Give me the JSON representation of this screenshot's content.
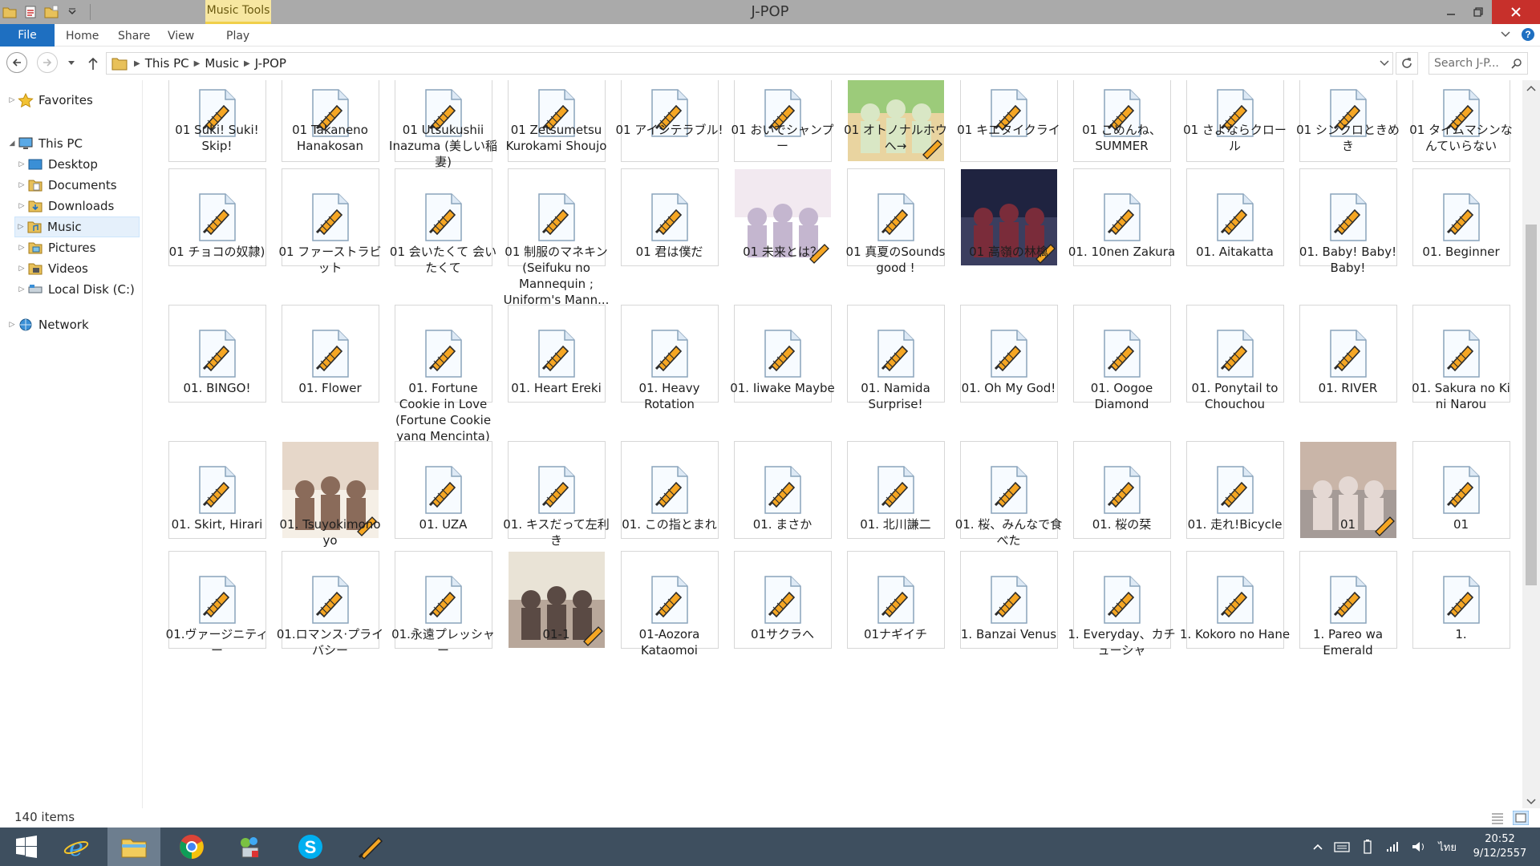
{
  "window": {
    "title": "J-POP",
    "context_tab": "Music Tools"
  },
  "ribbon": {
    "file": "File",
    "tabs": [
      "Home",
      "Share",
      "View",
      "Play"
    ]
  },
  "address": {
    "segments": [
      "This PC",
      "Music",
      "J-POP"
    ],
    "search_placeholder": "Search J-P..."
  },
  "nav": {
    "favorites": "Favorites",
    "this_pc": "This PC",
    "items": [
      "Desktop",
      "Documents",
      "Downloads",
      "Music",
      "Pictures",
      "Videos",
      "Local Disk (C:)"
    ],
    "network": "Network"
  },
  "files": [
    {
      "name": "01 Suki! Suki! Skip!",
      "thumb": "generic"
    },
    {
      "name": "01 Takaneno Hanakosan",
      "thumb": "generic"
    },
    {
      "name": "01 Utsukushii Inazuma (美しい稲妻)",
      "thumb": "generic"
    },
    {
      "name": "01 Zetsumetsu Kurokami Shoujo",
      "thumb": "generic"
    },
    {
      "name": "01 アイシテラブル!",
      "thumb": "generic"
    },
    {
      "name": "01 おいでシャンプー",
      "thumb": "generic"
    },
    {
      "name": "01 オトノナルホウへ→",
      "thumb": "photo"
    },
    {
      "name": "01 キエタイクライ",
      "thumb": "generic"
    },
    {
      "name": "01 ごめんね、SUMMER",
      "thumb": "generic"
    },
    {
      "name": "01 さよならクロール",
      "thumb": "generic"
    },
    {
      "name": "01 シンクロときめき",
      "thumb": "generic"
    },
    {
      "name": "01 タイムマシンなんていらない",
      "thumb": "generic"
    },
    {
      "name": "01 チョコの奴隷)",
      "thumb": "generic"
    },
    {
      "name": "01 ファーストラビット",
      "thumb": "generic"
    },
    {
      "name": "01 会いたくて 会いたくて",
      "thumb": "generic"
    },
    {
      "name": "01 制服のマネキン (Seifuku no Mannequin ; Uniform's Mann...",
      "thumb": "generic"
    },
    {
      "name": "01 君は僕だ",
      "thumb": "generic"
    },
    {
      "name": "01 未来とは？",
      "thumb": "photo"
    },
    {
      "name": "01 真夏のSounds good !",
      "thumb": "generic"
    },
    {
      "name": "01 高嶺の林檎",
      "thumb": "photo"
    },
    {
      "name": "01. 10nen Zakura",
      "thumb": "generic"
    },
    {
      "name": "01. Aitakatta",
      "thumb": "generic"
    },
    {
      "name": "01. Baby! Baby! Baby!",
      "thumb": "generic"
    },
    {
      "name": "01. Beginner",
      "thumb": "generic"
    },
    {
      "name": "01. BINGO!",
      "thumb": "generic"
    },
    {
      "name": "01. Flower",
      "thumb": "generic"
    },
    {
      "name": "01. Fortune Cookie in Love (Fortune Cookie yang Mencinta)",
      "thumb": "generic"
    },
    {
      "name": "01. Heart Ereki",
      "thumb": "generic"
    },
    {
      "name": "01. Heavy Rotation",
      "thumb": "generic"
    },
    {
      "name": "01. Iiwake Maybe",
      "thumb": "generic"
    },
    {
      "name": "01. Namida Surprise!",
      "thumb": "generic"
    },
    {
      "name": "01. Oh My God!",
      "thumb": "generic"
    },
    {
      "name": "01. Oogoe Diamond",
      "thumb": "generic"
    },
    {
      "name": "01. Ponytail to Chouchou",
      "thumb": "generic"
    },
    {
      "name": "01. RIVER",
      "thumb": "generic"
    },
    {
      "name": "01. Sakura no Ki ni Narou",
      "thumb": "generic"
    },
    {
      "name": "01. Skirt, Hirari",
      "thumb": "generic"
    },
    {
      "name": "01. Tsuyokimono yo",
      "thumb": "photo"
    },
    {
      "name": "01. UZA",
      "thumb": "generic"
    },
    {
      "name": "01. キスだって左利き",
      "thumb": "generic"
    },
    {
      "name": "01. この指とまれ",
      "thumb": "generic"
    },
    {
      "name": "01. まさか",
      "thumb": "generic"
    },
    {
      "name": "01. 北川謙二",
      "thumb": "generic"
    },
    {
      "name": "01. 桜、みんなで食べた",
      "thumb": "generic"
    },
    {
      "name": "01. 桜の栞",
      "thumb": "generic"
    },
    {
      "name": "01. 走れ!Bicycle",
      "thumb": "generic"
    },
    {
      "name": "01",
      "thumb": "photo"
    },
    {
      "name": "01",
      "thumb": "generic"
    },
    {
      "name": "01.ヴァージニティー",
      "thumb": "generic"
    },
    {
      "name": "01.ロマンス·プライバシー",
      "thumb": "generic"
    },
    {
      "name": "01.永遠プレッシャー",
      "thumb": "generic"
    },
    {
      "name": "01-1",
      "thumb": "photo"
    },
    {
      "name": "01-Aozora Kataomoi",
      "thumb": "generic"
    },
    {
      "name": "01サクラへ",
      "thumb": "generic"
    },
    {
      "name": "01ナギイチ",
      "thumb": "generic"
    },
    {
      "name": "1. Banzai Venus",
      "thumb": "generic"
    },
    {
      "name": "1. Everyday、カチューシャ",
      "thumb": "generic"
    },
    {
      "name": "1. Kokoro no Hane",
      "thumb": "generic"
    },
    {
      "name": "1. Pareo wa Emerald",
      "thumb": "generic"
    },
    {
      "name": "1.",
      "thumb": "generic"
    }
  ],
  "status": {
    "count": "140 items"
  },
  "taskbar": {
    "time": "20:52",
    "date": "9/12/2557",
    "lang": "ไทย"
  },
  "colors": {
    "accent": "#1e6fc1",
    "titlebar": "#aaaaaa",
    "taskbar": "#3e4f5f",
    "close": "#c7302b",
    "context": "#f7e7a1"
  }
}
